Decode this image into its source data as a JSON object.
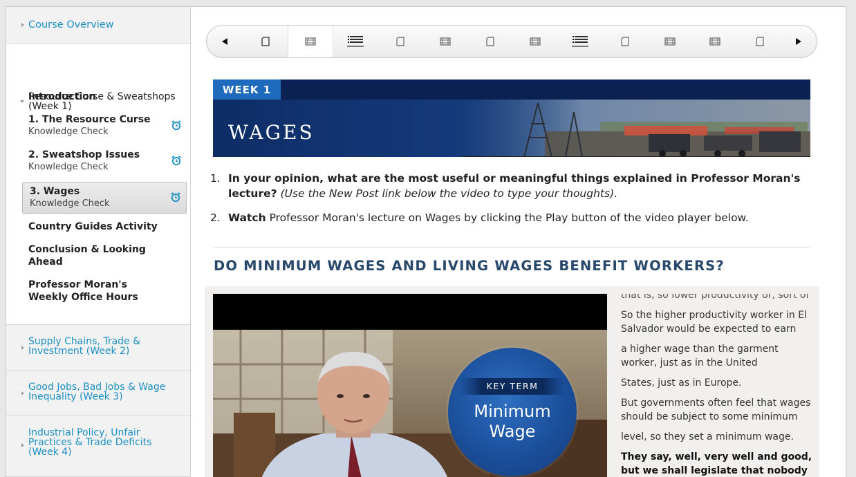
{
  "sidebar": {
    "overview_label": "Course Overview",
    "open_section_title": "Resource Curse & Sweatshops (Week 1)",
    "items": [
      {
        "label": "Introduction",
        "sub": ""
      },
      {
        "label": "1. The Resource Curse",
        "sub": "Knowledge Check"
      },
      {
        "label": "2. Sweatshop Issues",
        "sub": "Knowledge Check"
      },
      {
        "label": "3. Wages",
        "sub": "Knowledge Check"
      },
      {
        "label": "Country Guides Activity",
        "sub": ""
      },
      {
        "label": "Conclusion & Looking Ahead",
        "sub": ""
      },
      {
        "label": "Professor Moran's Weekly Office Hours",
        "sub": ""
      }
    ],
    "closed_sections": [
      "Supply Chains, Trade & Investment (Week 2)",
      "Good Jobs, Bad Jobs & Wage Inequality (Week 3)",
      "Industrial Policy, Unfair Practices & Trade Deficits (Week 4)"
    ]
  },
  "nav": {
    "items": [
      "page-icon",
      "video-icon",
      "list-icon",
      "page-icon",
      "video-icon",
      "page-icon",
      "video-icon",
      "list-icon",
      "page-icon",
      "video-icon",
      "video-icon",
      "page-icon"
    ],
    "selected_index": 1
  },
  "banner": {
    "week": "WEEK 1",
    "title": "WAGES"
  },
  "instructions": {
    "item1_num": "1.",
    "item1_bold": "In your opinion, what are the most useful or meaningful things explained in Professor Moran's lecture?",
    "item1_italic": "(Use the New Post link below the video to type your thoughts).",
    "item2_num": "2.",
    "item2_bold": "Watch",
    "item2_text": "Professor Moran's lecture on Wages by clicking the Play button of the video player below."
  },
  "section_heading": "DO MINIMUM WAGES AND LIVING WAGES BENEFIT WORKERS?",
  "video": {
    "key_term_label": "KEY TERM",
    "key_term_line1": "Minimum",
    "key_term_line2": "Wage"
  },
  "transcript": {
    "clipped": "that is, so lower productivity or, sort of",
    "lines": [
      "So the higher productivity worker in El Salvador would be expected to earn",
      "a higher wage than the garment worker, just as in the United",
      "States, just as in Europe.",
      "But governments often feel that wages should be subject to some minimum",
      "level, so they set a minimum wage."
    ],
    "strong": "They say, well, very well and good, but we shall legislate that nobody is"
  },
  "colors": {
    "link": "#1b8fc4",
    "banner_tab": "#1e6bbd",
    "heading": "#27476b",
    "alarm": "#1b8fc4"
  }
}
